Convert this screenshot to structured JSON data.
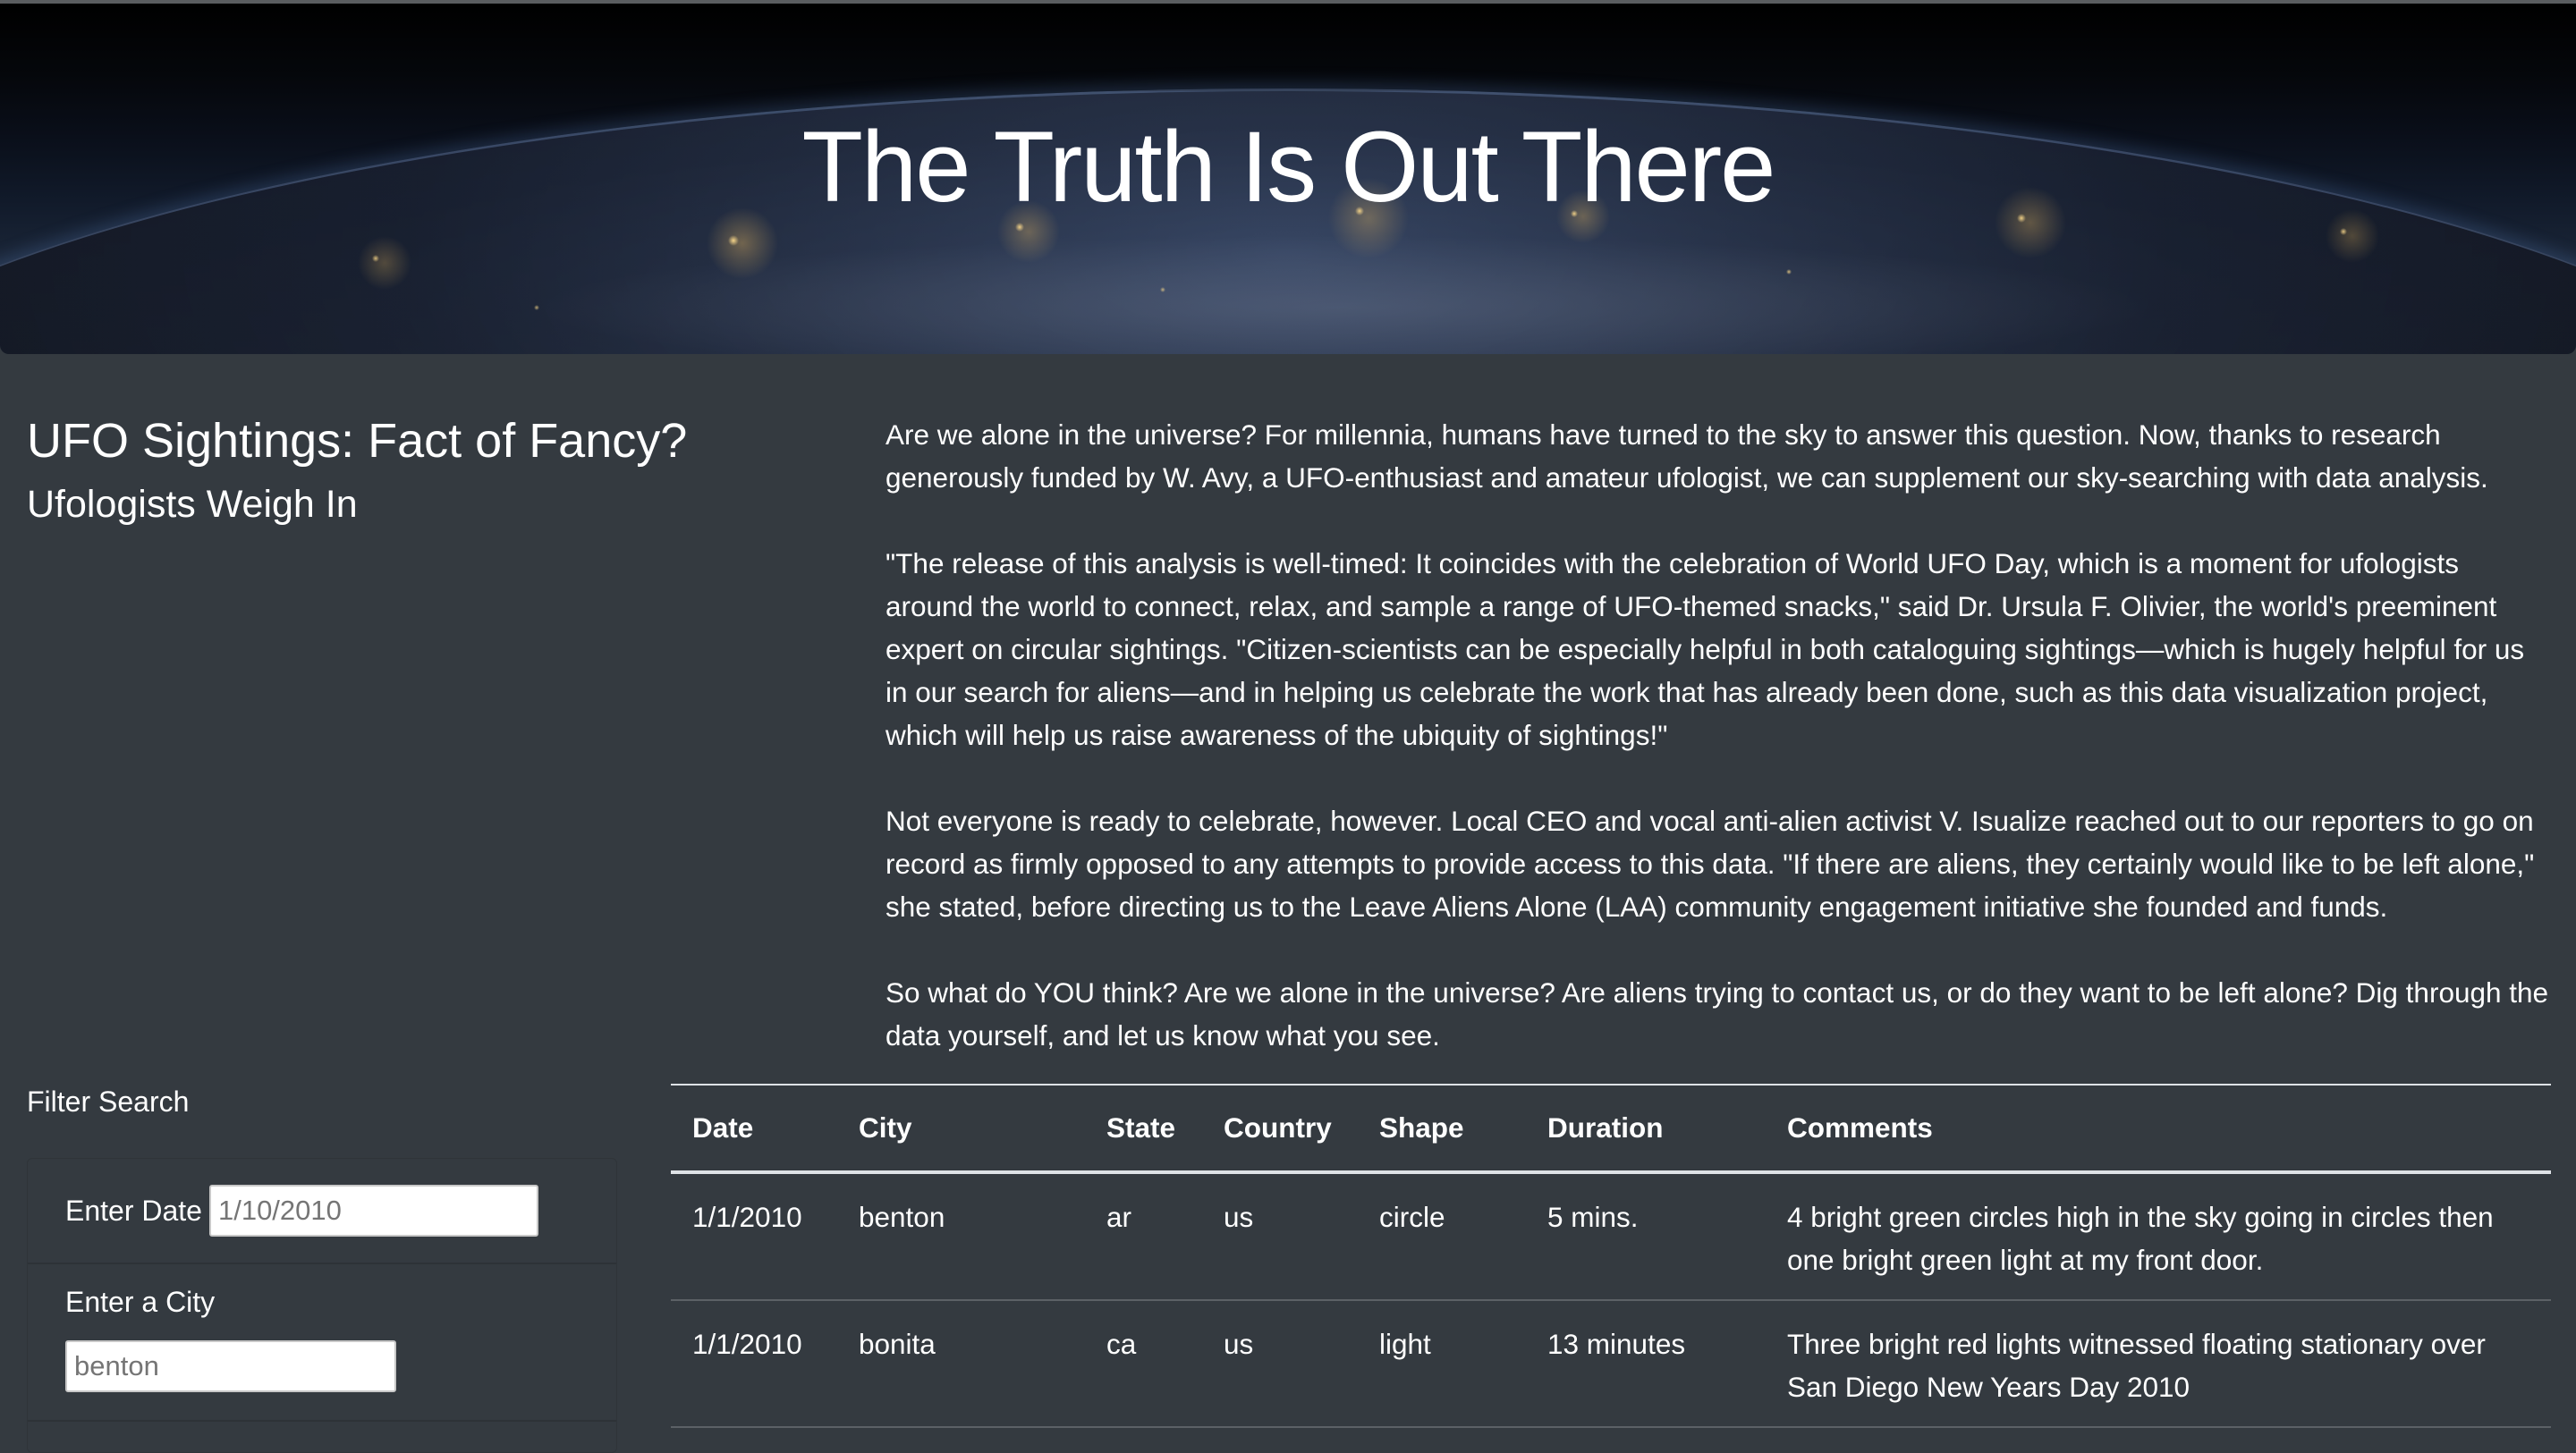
{
  "hero": {
    "title": "The Truth Is Out There"
  },
  "intro": {
    "title": "UFO Sightings: Fact of Fancy?",
    "subtitle": "Ufologists Weigh In"
  },
  "article": {
    "paragraphs": [
      "Are we alone in the universe? For millennia, humans have turned to the sky to answer this question. Now, thanks to research generously funded by W. Avy, a UFO-enthusiast and amateur ufologist, we can supplement our sky-searching with data analysis.",
      "\"The release of this analysis is well-timed: It coincides with the celebration of World UFO Day, which is a moment for ufologists around the world to connect, relax, and sample a range of UFO-themed snacks,\" said Dr. Ursula F. Olivier, the world's preeminent expert on circular sightings. \"Citizen-scientists can be especially helpful in both cataloguing sightings—which is hugely helpful for us in our search for aliens—and in helping us celebrate the work that has already been done, such as this data visualization project, which will help us raise awareness of the ubiquity of sightings!\"",
      "Not everyone is ready to celebrate, however. Local CEO and vocal anti-alien activist V. Isualize reached out to our reporters to go on record as firmly opposed to any attempts to provide access to this data. \"If there are aliens, they certainly would like to be left alone,\" she stated, before directing us to the Leave Aliens Alone (LAA) community engagement initiative she founded and funds.",
      "So what do YOU think? Are we alone in the universe? Are aliens trying to contact us, or do they want to be left alone? Dig through the data yourself, and let us know what you see."
    ]
  },
  "filter": {
    "title": "Filter Search",
    "date_label": "Enter Date",
    "date_value": "1/10/2010",
    "city_label": "Enter a City",
    "city_value": "benton"
  },
  "table": {
    "headers": {
      "date": "Date",
      "city": "City",
      "state": "State",
      "country": "Country",
      "shape": "Shape",
      "duration": "Duration",
      "comments": "Comments"
    },
    "rows": [
      {
        "date": "1/1/2010",
        "city": "benton",
        "state": "ar",
        "country": "us",
        "shape": "circle",
        "duration": "5 mins.",
        "comments": "4 bright green circles high in the sky going in circles then one bright green light at my front door."
      },
      {
        "date": "1/1/2010",
        "city": "bonita",
        "state": "ca",
        "country": "us",
        "shape": "light",
        "duration": "13 minutes",
        "comments": "Three bright red lights witnessed floating stationary over San Diego New Years Day 2010"
      }
    ]
  }
}
